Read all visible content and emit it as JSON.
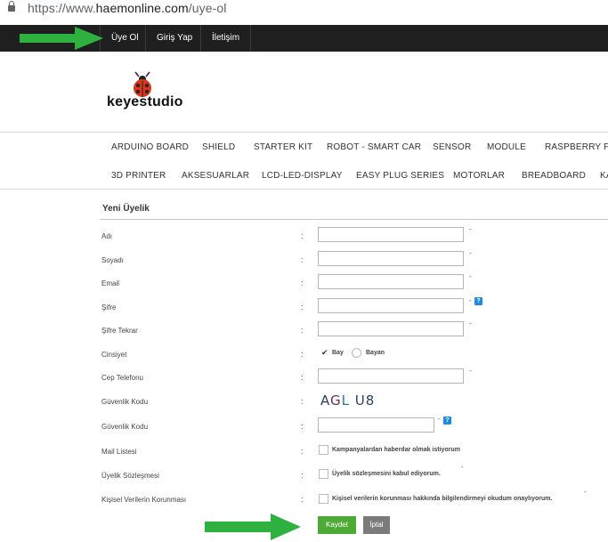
{
  "browser": {
    "url_prefix": "https://www.",
    "url_host": "haemonline.com",
    "url_path": "/uye-ol"
  },
  "topnav": {
    "items": [
      "Üye Ol",
      "Giriş Yap",
      "İletişim"
    ]
  },
  "logo": {
    "text": "keyestudio"
  },
  "categories": {
    "row1": [
      "ARDUINO BOARD",
      "SHIELD",
      "STARTER KIT",
      "ROBOT - SMART CAR",
      "SENSOR",
      "MODULE",
      "RASPBERRY PI"
    ],
    "row2": [
      "3D PRINTER",
      "AKSESUARLAR",
      "LCD-LED-DISPLAY",
      "EASY PLUG SERIES",
      "MOTORLAR",
      "BREADBOARD",
      "KA"
    ]
  },
  "form": {
    "title": "Yeni Üyelik",
    "colon": ":",
    "required_mark": "-",
    "help_mark": "?",
    "fields": {
      "name": "Adı",
      "surname": "Soyadı",
      "email": "Email",
      "password": "Şifre",
      "password_repeat": "Şifre Tekrar",
      "gender": "Cinsiyet",
      "phone": "Cep Telefonu",
      "security_code_image": "Güvenlik Kodu",
      "security_code": "Güvenlik Kodu",
      "mailing_list": "Mail Listesi",
      "membership_agreement": "Üyelik Sözleşmesi",
      "data_protection": "Kişisel Verilerin Korunması"
    },
    "gender_options": {
      "male": "Bay",
      "female": "Bayan",
      "selected": "Bay"
    },
    "captcha": {
      "c1": "A",
      "c2": "G",
      "c3": "L",
      "c4": " U8"
    },
    "checkboxes": {
      "mailing_list": "Kampanyalardan haberdar olmak istiyorum",
      "membership_agreement": "Üyelik sözleşmesini kabul ediyorum.",
      "data_protection": "Kişisel verilerin korunması hakkında bilgilendirmeyi okudum onaylıyorum."
    },
    "buttons": {
      "save": "Kaydet",
      "cancel": "İptal"
    }
  },
  "colors": {
    "topnav_bg": "#1f1f1f",
    "save_button": "#4caa35",
    "cancel_button": "#7b7b7b",
    "help_icon": "#1e8be6",
    "annotation_arrow": "#2fb13f"
  },
  "icons": [
    "lock-icon",
    "ladybug-logo-icon",
    "help-icon",
    "green-arrow-icon"
  ]
}
